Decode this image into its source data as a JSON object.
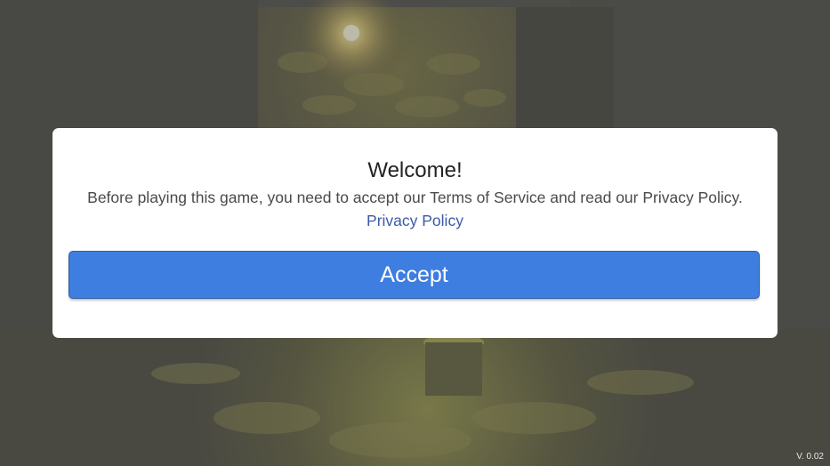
{
  "dialog": {
    "title": "Welcome!",
    "message": "Before playing this game, you need to accept our Terms of Service and read our Privacy Policy.",
    "privacy_link": "Privacy Policy",
    "accept_label": "Accept"
  },
  "version": "V. 0.02",
  "colors": {
    "accent": "#3d7ee0",
    "link": "#3b5aa8",
    "dialog_bg": "#ffffff"
  }
}
